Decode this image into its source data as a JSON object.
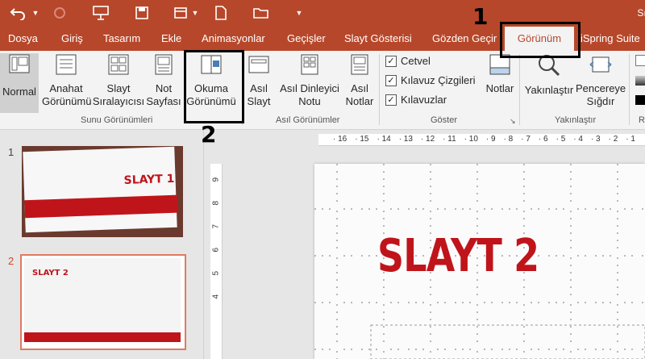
{
  "colors": {
    "accent": "#b7472a",
    "selected_thumb": "#d24726",
    "slide_red": "#c0141b"
  },
  "quick_access": {
    "title_partial": "Sı"
  },
  "tabs": [
    {
      "label": "Dosya"
    },
    {
      "label": "Giriş"
    },
    {
      "label": "Tasarım"
    },
    {
      "label": "Ekle"
    },
    {
      "label": "Animasyonlar"
    },
    {
      "label": "Geçişler"
    },
    {
      "label": "Slayt Gösterisi"
    },
    {
      "label": "Gözden Geçir"
    },
    {
      "label": "Görünüm",
      "active": true
    },
    {
      "label": "iSpring Suite"
    }
  ],
  "ribbon": {
    "presentation_views": {
      "group_label": "Sunu Görünümleri",
      "normal": "Normal",
      "outline_1": "Anahat",
      "outline_2": "Görünümü",
      "sorter_1": "Slayt",
      "sorter_2": "Sıralayıcısı",
      "notes_1": "Not",
      "notes_2": "Sayfası",
      "reading_1": "Okuma",
      "reading_2": "Görünümü"
    },
    "master_views": {
      "group_label": "Asıl Görünümler",
      "slide_1": "Asıl",
      "slide_2": "Slayt",
      "handout_1": "Asıl Dinleyici",
      "handout_2": "Notu",
      "notes_1": "Asıl",
      "notes_2": "Notlar"
    },
    "show": {
      "group_label": "Göster",
      "ruler": "Cetvel",
      "gridlines": "Kılavuz Çizgileri",
      "guides": "Kılavuzlar",
      "notes": "Notlar"
    },
    "zoom": {
      "group_label": "Yakınlaştır",
      "zoom": "Yakınlaştır",
      "fit_1": "Pencereye",
      "fit_2": "Sığdır"
    },
    "color_group_partial": "R"
  },
  "thumbnails": [
    {
      "number": "1",
      "title": "SLAYT 1"
    },
    {
      "number": "2",
      "title": "SLAYT 2"
    }
  ],
  "ruler": {
    "h_ticks": [
      "16",
      "15",
      "14",
      "13",
      "12",
      "11",
      "10",
      "9",
      "8",
      "7",
      "6",
      "5",
      "4",
      "3",
      "2",
      "1"
    ],
    "v_ticks": [
      "9",
      "8",
      "7",
      "6",
      "5",
      "4"
    ]
  },
  "slide": {
    "title": "SLAYT 2"
  },
  "annotations": {
    "one": "1",
    "two": "2"
  }
}
